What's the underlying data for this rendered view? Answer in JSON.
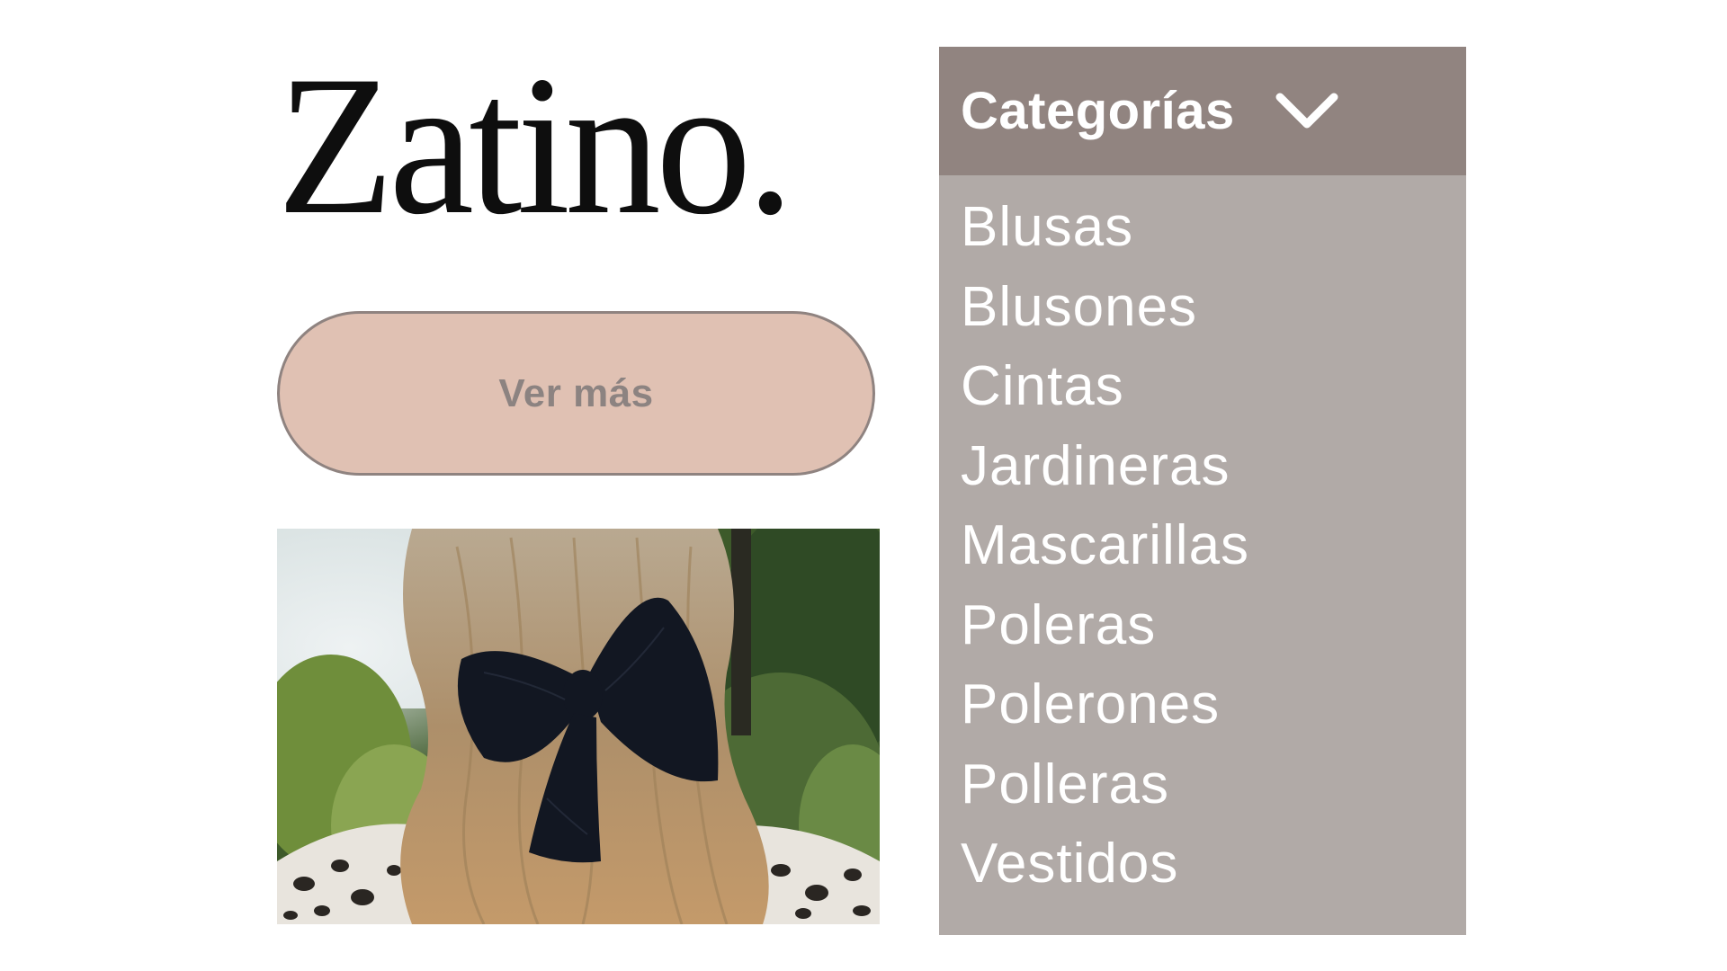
{
  "brand": {
    "logo_text": "Zatino."
  },
  "hero": {
    "button_label": "Ver más"
  },
  "menu": {
    "title": "Categorías",
    "toggle_icon": "chevron-down-icon",
    "items": [
      {
        "label": "Blusas"
      },
      {
        "label": "Blusones"
      },
      {
        "label": "Cintas"
      },
      {
        "label": "Jardineras"
      },
      {
        "label": "Mascarillas"
      },
      {
        "label": "Poleras"
      },
      {
        "label": "Polerones"
      },
      {
        "label": "Polleras"
      },
      {
        "label": "Vestidos"
      }
    ]
  },
  "colors": {
    "button_fill": "#e0c1b3",
    "button_border": "#8f8380",
    "button_text": "#8c8381",
    "menu_header": "#918480",
    "menu_body": "#b1aaa7",
    "menu_text": "#ffffff"
  }
}
